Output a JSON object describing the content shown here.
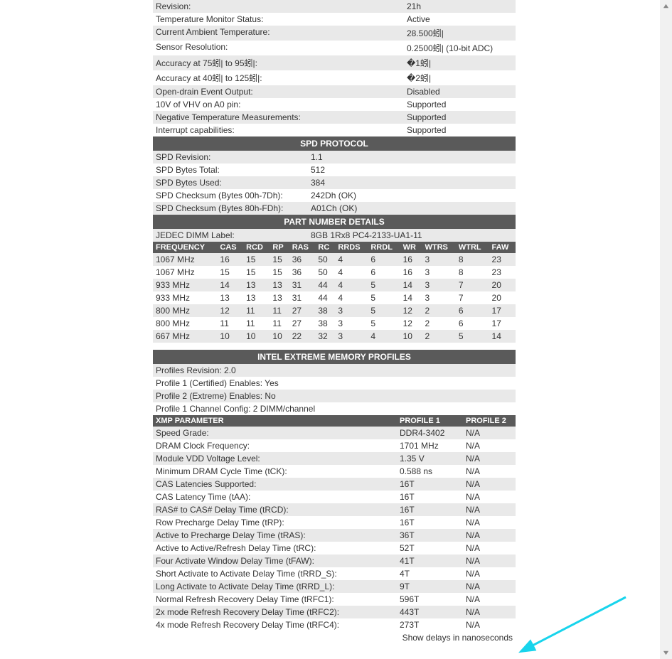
{
  "top_rows": [
    {
      "label": "Revision:",
      "value": "21h",
      "alt": true
    },
    {
      "label": "Temperature Monitor Status:",
      "value": "Active",
      "alt": false
    },
    {
      "label": "Current Ambient Temperature:",
      "value": "28.500蚓|",
      "alt": true
    },
    {
      "label": "Sensor Resolution:",
      "value": "0.2500蚓| (10-bit ADC)",
      "alt": false
    },
    {
      "label": "Accuracy at 75蚓| to 95蚓|:",
      "value": "�1蚓|",
      "alt": true
    },
    {
      "label": "Accuracy at 40蚓| to 125蚓|:",
      "value": "�2蚓|",
      "alt": false
    },
    {
      "label": "Open-drain Event Output:",
      "value": "Disabled",
      "alt": true
    },
    {
      "label": "10V of VHV on A0 pin:",
      "value": "Supported",
      "alt": false
    },
    {
      "label": "Negative Temperature Measurements:",
      "value": "Supported",
      "alt": true
    },
    {
      "label": "Interrupt capabilities:",
      "value": "Supported",
      "alt": false
    }
  ],
  "section_spd": "SPD PROTOCOL",
  "spd_rows": [
    {
      "label": "SPD Revision:",
      "value": "1.1",
      "alt": true
    },
    {
      "label": "SPD Bytes Total:",
      "value": "512",
      "alt": false
    },
    {
      "label": "SPD Bytes Used:",
      "value": "384",
      "alt": true
    },
    {
      "label": "SPD Checksum (Bytes 00h-7Dh):",
      "value": "242Dh (OK)",
      "alt": false
    },
    {
      "label": "SPD Checksum (Bytes 80h-FDh):",
      "value": "A01Ch (OK)",
      "alt": true
    }
  ],
  "section_part": "PART NUMBER DETAILS",
  "jedec_label": "JEDEC DIMM Label:",
  "jedec_value": "8GB 1Rx8 PC4-2133-UA1-11",
  "timing_headers": [
    "FREQUENCY",
    "CAS",
    "RCD",
    "RP",
    "RAS",
    "RC",
    "RRDS",
    "RRDL",
    "WR",
    "WTRS",
    "WTRL",
    "FAW"
  ],
  "timing_rows": [
    {
      "alt": true,
      "cells": [
        "1067 MHz",
        "16",
        "15",
        "15",
        "36",
        "50",
        "4",
        "6",
        "16",
        "3",
        "8",
        "23"
      ]
    },
    {
      "alt": false,
      "cells": [
        "1067 MHz",
        "15",
        "15",
        "15",
        "36",
        "50",
        "4",
        "6",
        "16",
        "3",
        "8",
        "23"
      ]
    },
    {
      "alt": true,
      "cells": [
        "933 MHz",
        "14",
        "13",
        "13",
        "31",
        "44",
        "4",
        "5",
        "14",
        "3",
        "7",
        "20"
      ]
    },
    {
      "alt": false,
      "cells": [
        "933 MHz",
        "13",
        "13",
        "13",
        "31",
        "44",
        "4",
        "5",
        "14",
        "3",
        "7",
        "20"
      ]
    },
    {
      "alt": true,
      "cells": [
        "800 MHz",
        "12",
        "11",
        "11",
        "27",
        "38",
        "3",
        "5",
        "12",
        "2",
        "6",
        "17"
      ]
    },
    {
      "alt": false,
      "cells": [
        "800 MHz",
        "11",
        "11",
        "11",
        "27",
        "38",
        "3",
        "5",
        "12",
        "2",
        "6",
        "17"
      ]
    },
    {
      "alt": true,
      "cells": [
        "667 MHz",
        "10",
        "10",
        "10",
        "22",
        "32",
        "3",
        "4",
        "10",
        "2",
        "5",
        "14"
      ]
    }
  ],
  "section_xmp": "INTEL EXTREME MEMORY PROFILES",
  "xmp_info": [
    {
      "text": "Profiles Revision: 2.0",
      "alt": true
    },
    {
      "text": "Profile 1 (Certified) Enables: Yes",
      "alt": false
    },
    {
      "text": "Profile 2 (Extreme) Enables: No",
      "alt": true
    },
    {
      "text": "Profile 1 Channel Config: 2 DIMM/channel",
      "alt": false
    }
  ],
  "xmp_headers": [
    "XMP PARAMETER",
    "PROFILE 1",
    "PROFILE 2"
  ],
  "xmp_rows": [
    {
      "alt": true,
      "p": "Speed Grade:",
      "v1": "DDR4-3402",
      "v2": "N/A"
    },
    {
      "alt": false,
      "p": "DRAM Clock Frequency:",
      "v1": "1701 MHz",
      "v2": "N/A"
    },
    {
      "alt": true,
      "p": "Module VDD Voltage Level:",
      "v1": "1.35 V",
      "v2": "N/A"
    },
    {
      "alt": false,
      "p": "Minimum DRAM Cycle Time (tCK):",
      "v1": "0.588 ns",
      "v2": "N/A"
    },
    {
      "alt": true,
      "p": "CAS Latencies Supported:",
      "v1": "16T",
      "v2": "N/A"
    },
    {
      "alt": false,
      "p": "CAS Latency Time (tAA):",
      "v1": "16T",
      "v2": "N/A"
    },
    {
      "alt": true,
      "p": "RAS# to CAS# Delay Time (tRCD):",
      "v1": "16T",
      "v2": "N/A"
    },
    {
      "alt": false,
      "p": "Row Precharge Delay Time (tRP):",
      "v1": "16T",
      "v2": "N/A"
    },
    {
      "alt": true,
      "p": "Active to Precharge Delay Time (tRAS):",
      "v1": "36T",
      "v2": "N/A"
    },
    {
      "alt": false,
      "p": "Active to Active/Refresh Delay Time (tRC):",
      "v1": "52T",
      "v2": "N/A"
    },
    {
      "alt": true,
      "p": "Four Activate Window Delay Time (tFAW):",
      "v1": "41T",
      "v2": "N/A"
    },
    {
      "alt": false,
      "p": "Short Activate to Activate Delay Time (tRRD_S):",
      "v1": "4T",
      "v2": "N/A"
    },
    {
      "alt": true,
      "p": "Long Activate to Activate Delay Time (tRRD_L):",
      "v1": "9T",
      "v2": "N/A"
    },
    {
      "alt": false,
      "p": "Normal Refresh Recovery Delay Time (tRFC1):",
      "v1": "596T",
      "v2": "N/A"
    },
    {
      "alt": true,
      "p": "2x mode Refresh Recovery Delay Time (tRFC2):",
      "v1": "443T",
      "v2": "N/A"
    },
    {
      "alt": false,
      "p": "4x mode Refresh Recovery Delay Time (tRFC4):",
      "v1": "273T",
      "v2": "N/A"
    }
  ],
  "show_link": "Show delays in nanoseconds"
}
